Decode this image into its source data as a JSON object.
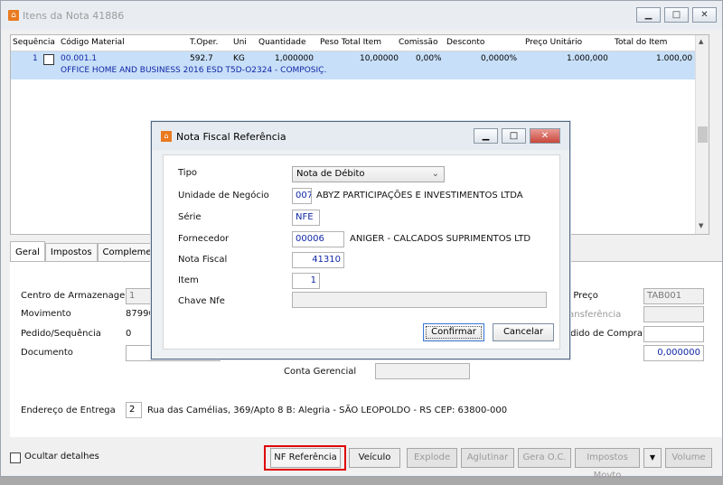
{
  "window": {
    "title": "Itens da Nota 41886",
    "min": "▁",
    "max": "□",
    "close": "✕"
  },
  "grid": {
    "headers": [
      "Sequência",
      "Código Material",
      "T.Oper.",
      "Uni",
      "Quantidade",
      "Peso Total Item",
      "Comissão",
      "Desconto",
      "Preço Unitário",
      "Total do Item"
    ],
    "row": {
      "seq": "1",
      "codigo": "00.001.1",
      "toper": "592.7",
      "uni": "KG",
      "quantidade": "1,000000",
      "peso": "10,00000",
      "comissao": "0,00%",
      "desconto": "0,0000%",
      "preco": "1.000,000",
      "total": "1.000,00",
      "descricao": "OFFICE HOME AND BUSINESS 2016 ESD T5D-O2324 - COMPOSIÇ."
    }
  },
  "tabs": [
    "Geral",
    "Impostos",
    "Complemento"
  ],
  "main": {
    "centro_label": "Centro de Armazenagem",
    "centro_value": "1",
    "movimento_label": "Movimento",
    "movimento_value": "87990",
    "pedido_label": "Pedido/Sequência",
    "pedido_value": "0",
    "documento_label": "Documento",
    "conta_label": "Conta Gerencial",
    "endereco_label": "Endereço de Entrega",
    "endereco_num": "2",
    "endereco_value": "Rua das Camélias, 369/Apto 8 B: Alegria - SÃO LEOPOLDO - RS CEP: 63800-000",
    "preco_label": "e Preço",
    "preco_value": "TAB001",
    "transf_label": "ransferência",
    "compra_label": "edido de Compra",
    "valor_value": "0,000000"
  },
  "dialog": {
    "title": "Nota Fiscal Referência",
    "tipo_label": "Tipo",
    "tipo_value": "Nota de Débito",
    "unidade_label": "Unidade de Negócio",
    "unidade_code": "007",
    "unidade_name": "ABYZ PARTICIPAÇÕES E INVESTIMENTOS LTDA",
    "serie_label": "Série",
    "serie_value": "NFE",
    "fornecedor_label": "Fornecedor",
    "fornecedor_code": "00006",
    "fornecedor_name": "ANIGER - CALCADOS SUPRIMENTOS LTD",
    "nota_label": "Nota Fiscal",
    "nota_value": "41310",
    "item_label": "Item",
    "item_value": "1",
    "chave_label": "Chave Nfe",
    "confirm": "Confirmar",
    "cancel": "Cancelar"
  },
  "bottom": {
    "ocultar": "Ocultar detalhes",
    "buttons": [
      "NF Referência",
      "Veículo",
      "Explode",
      "Aglutinar",
      "Gera O.C.",
      "Impostos Movto",
      "▼",
      "Volume"
    ]
  }
}
